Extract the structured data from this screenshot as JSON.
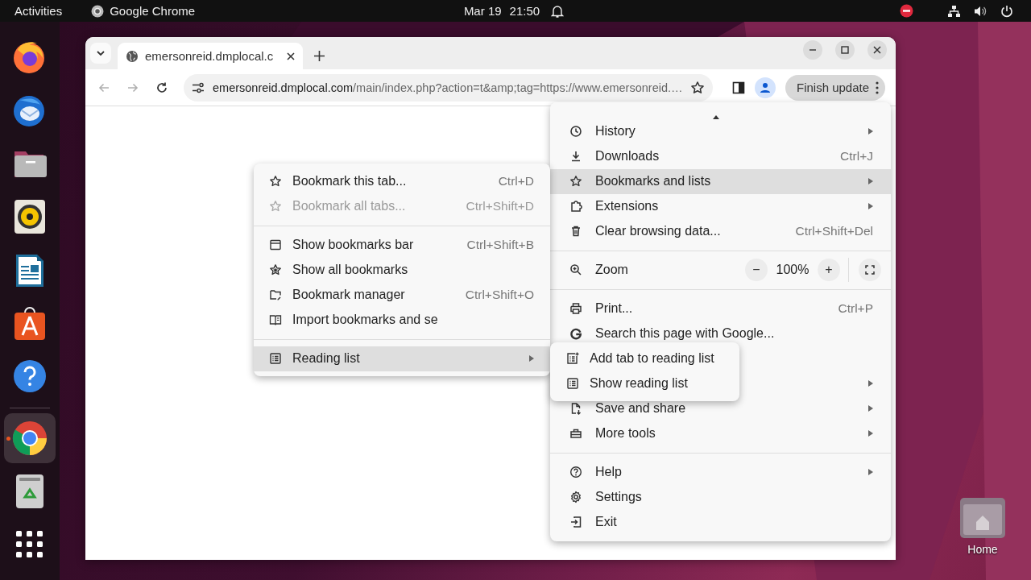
{
  "top_bar": {
    "activities": "Activities",
    "app": "Google Chrome",
    "date": "Mar 19",
    "time": "21:50"
  },
  "dock": [
    {
      "kind": "firefox",
      "active": false
    },
    {
      "kind": "thunderbird",
      "active": false
    },
    {
      "kind": "files",
      "active": false
    },
    {
      "kind": "rhythmbox",
      "active": false
    },
    {
      "kind": "writer",
      "active": false
    },
    {
      "kind": "appcenter",
      "active": false
    },
    {
      "kind": "help",
      "active": false
    },
    {
      "kind": "separator"
    },
    {
      "kind": "chrome",
      "active": true
    },
    {
      "kind": "trash",
      "active": false
    },
    {
      "kind": "apps",
      "active": false
    }
  ],
  "desktop_icons": [
    {
      "label": "Home"
    }
  ],
  "browser": {
    "tabs": [
      {
        "title": "emersonreid.dmplocal.c",
        "selected": true
      }
    ],
    "back": {
      "disabled": true
    },
    "forward": {
      "disabled": true
    },
    "url": {
      "host": "emersonreid.dmplocal.com",
      "path": "/main/index.php?action=t&amp;tag=https://www.emersonreid.…"
    },
    "update_button": "Finish update"
  },
  "main_menu": {
    "items": [
      {
        "kind": "item",
        "label": "History",
        "submenu": true,
        "highlighted": false
      },
      {
        "kind": "item",
        "label": "Downloads",
        "shortcut": "Ctrl+J",
        "submenu": false,
        "highlighted": false
      },
      {
        "kind": "item",
        "label": "Bookmarks and lists",
        "submenu": true,
        "highlighted": true
      },
      {
        "kind": "item",
        "label": "Extensions",
        "submenu": true,
        "highlighted": false
      },
      {
        "kind": "item",
        "label": "Clear browsing data...",
        "shortcut": "Ctrl+Shift+Del",
        "submenu": false,
        "highlighted": false
      },
      {
        "kind": "separator"
      },
      {
        "kind": "zoom",
        "label": "Zoom",
        "value": "100%",
        "minus": "−",
        "plus": "+"
      },
      {
        "kind": "separator"
      },
      {
        "kind": "item",
        "label": "Print...",
        "shortcut": "Ctrl+P",
        "submenu": false,
        "highlighted": false
      },
      {
        "kind": "item",
        "label": "Search this page with Google...",
        "submenu": false,
        "highlighted": false
      },
      {
        "kind": "item"
      },
      {
        "kind": "item",
        "submenu": true
      },
      {
        "kind": "item",
        "label": "Save and share",
        "submenu": true,
        "highlighted": false
      },
      {
        "kind": "item",
        "label": "More tools",
        "submenu": true,
        "highlighted": false
      },
      {
        "kind": "separator"
      },
      {
        "kind": "item",
        "label": "Help",
        "submenu": true,
        "highlighted": false
      },
      {
        "kind": "item",
        "label": "Settings",
        "submenu": false,
        "highlighted": false
      },
      {
        "kind": "item",
        "label": "Exit",
        "submenu": false,
        "highlighted": false
      }
    ]
  },
  "bookmarks_menu": {
    "items": [
      {
        "kind": "item",
        "label": "Bookmark this tab...",
        "shortcut": "Ctrl+D",
        "disabled": false,
        "submenu": false,
        "highlighted": false
      },
      {
        "kind": "item",
        "label": "Bookmark all tabs...",
        "shortcut": "Ctrl+Shift+D",
        "disabled": true,
        "submenu": false,
        "highlighted": false
      },
      {
        "kind": "separator"
      },
      {
        "kind": "item",
        "label": "Show bookmarks bar",
        "shortcut": "Ctrl+Shift+B",
        "disabled": false,
        "submenu": false,
        "highlighted": false
      },
      {
        "kind": "item",
        "label": "Show all bookmarks",
        "disabled": false,
        "submenu": false,
        "highlighted": false
      },
      {
        "kind": "item",
        "label": "Bookmark manager",
        "shortcut": "Ctrl+Shift+O",
        "disabled": false,
        "submenu": false,
        "highlighted": false
      },
      {
        "kind": "item",
        "label": "Import bookmarks and se",
        "disabled": false,
        "submenu": false,
        "highlighted": false
      },
      {
        "kind": "separator"
      },
      {
        "kind": "item",
        "label": "Reading list",
        "disabled": false,
        "submenu": true,
        "highlighted": true
      }
    ]
  },
  "reading_menu": {
    "items": [
      {
        "kind": "item",
        "label": "Add tab to reading list",
        "submenu": false,
        "highlighted": false
      },
      {
        "kind": "item",
        "label": "Show reading list",
        "submenu": false,
        "highlighted": false
      }
    ]
  }
}
